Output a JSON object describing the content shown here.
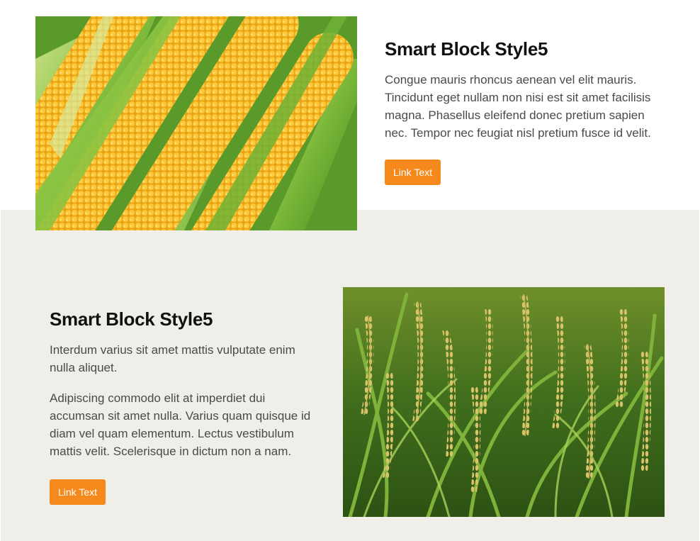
{
  "block1": {
    "title": "Smart Block Style5",
    "paragraph": "Congue mauris rhoncus aenean vel elit mauris. Tincidunt eget nullam non nisi est sit amet facilisis magna. Phasellus eleifend donec pretium sapien nec. Tempor nec feugiat nisl pretium fusce id velit.",
    "button_label": "Link Text",
    "image": "corn-cobs-photo"
  },
  "block2": {
    "title": "Smart Block Style5",
    "paragraph1": "Interdum varius sit amet mattis vulputate enim nulla aliquet.",
    "paragraph2": "Adipiscing commodo elit at imperdiet dui accumsan sit amet nulla. Varius quam quisque id diam vel quam elementum. Lectus vestibulum mattis velit. Scelerisque in dictum non a nam.",
    "button_label": "Link Text",
    "image": "rice-field-photo"
  },
  "colors": {
    "accent": "#f5891c",
    "band_background": "#efeee8",
    "title": "#111111",
    "body_text": "#4a4a4a"
  }
}
